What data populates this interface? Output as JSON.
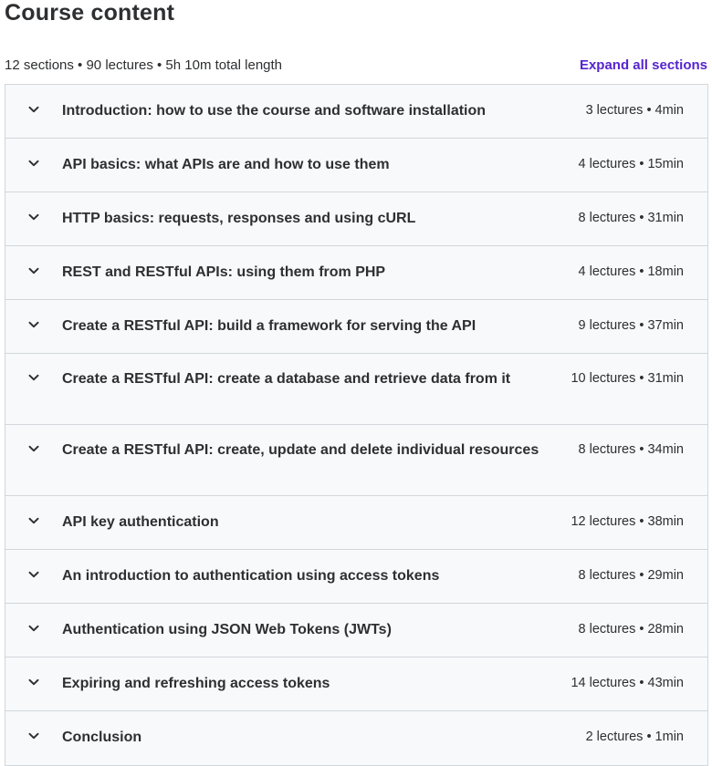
{
  "header": {
    "title": "Course content",
    "summary": "12 sections • 90 lectures • 5h 10m total length",
    "expand_label": "Expand all sections"
  },
  "icons": {
    "section_toggle": "chevron-down-icon"
  },
  "colors": {
    "accent": "#5624d0",
    "row_bg": "#f7f9fa",
    "border": "#d1d7dc",
    "text": "#2d2f31"
  },
  "sections": [
    {
      "title": "Introduction: how to use the course and software installation",
      "meta": "3 lectures • 4min"
    },
    {
      "title": "API basics: what APIs are and how to use them",
      "meta": "4 lectures • 15min"
    },
    {
      "title": "HTTP basics: requests, responses and using cURL",
      "meta": "8 lectures • 31min"
    },
    {
      "title": "REST and RESTful APIs: using them from PHP",
      "meta": "4 lectures • 18min"
    },
    {
      "title": "Create a RESTful API: build a framework for serving the API",
      "meta": "9 lectures • 37min"
    },
    {
      "title": "Create a RESTful API: create a database and retrieve data from it",
      "meta": "10 lectures • 31min"
    },
    {
      "title": "Create a RESTful API: create, update and delete individual resources",
      "meta": "8 lectures • 34min"
    },
    {
      "title": "API key authentication",
      "meta": "12 lectures • 38min"
    },
    {
      "title": "An introduction to authentication using access tokens",
      "meta": "8 lectures • 29min"
    },
    {
      "title": "Authentication using JSON Web Tokens (JWTs)",
      "meta": "8 lectures • 28min"
    },
    {
      "title": "Expiring and refreshing access tokens",
      "meta": "14 lectures • 43min"
    },
    {
      "title": "Conclusion",
      "meta": "2 lectures • 1min"
    }
  ]
}
